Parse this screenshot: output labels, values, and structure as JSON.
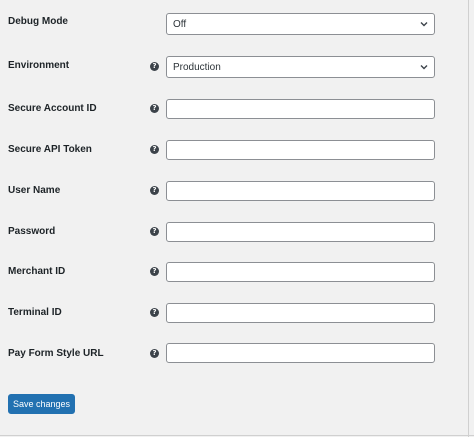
{
  "fields": {
    "debug_mode": {
      "label": "Debug Mode",
      "value": "Off"
    },
    "environment": {
      "label": "Environment",
      "value": "Production"
    },
    "secure_account_id": {
      "label": "Secure Account ID",
      "value": ""
    },
    "secure_api_token": {
      "label": "Secure API Token",
      "value": ""
    },
    "user_name": {
      "label": "User Name",
      "value": ""
    },
    "password": {
      "label": "Password",
      "value": ""
    },
    "merchant_id": {
      "label": "Merchant ID",
      "value": ""
    },
    "terminal_id": {
      "label": "Terminal ID",
      "value": ""
    },
    "pay_form_style_url": {
      "label": "Pay Form Style URL",
      "value": ""
    }
  },
  "help_glyph": "?",
  "help_icon": "help-circle",
  "dropdown_icon": "chevron-down",
  "actions": {
    "save_label": "Save changes"
  },
  "colors": {
    "background": "#f1f1f1",
    "primary_button": "#2271b1",
    "input_border": "#8c8f94",
    "help_icon": "#3c434a"
  }
}
